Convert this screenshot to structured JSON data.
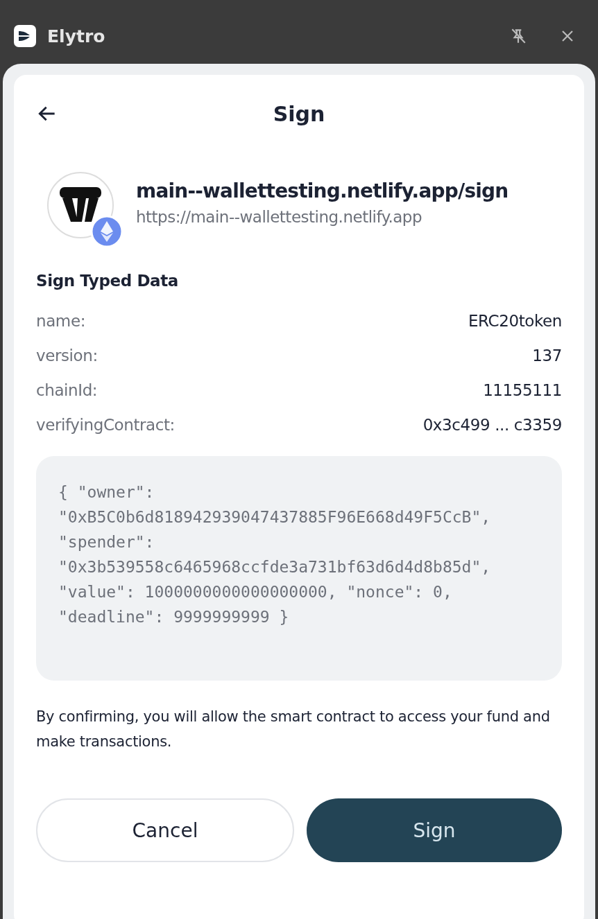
{
  "window": {
    "title": "Elytro",
    "pinned": false
  },
  "header": {
    "title": "Sign"
  },
  "site": {
    "title": "main--wallettesting.netlify.app/sign",
    "url": "https://main--wallettesting.netlify.app"
  },
  "section_title": "Sign Typed Data",
  "fields": [
    {
      "label": "name:",
      "value": "ERC20token"
    },
    {
      "label": "version:",
      "value": "137"
    },
    {
      "label": "chainId:",
      "value": "11155111"
    },
    {
      "label": "verifyingContract:",
      "value": "0x3c499 ... c3359"
    }
  ],
  "message": "{ \"owner\":\n\"0xB5C0b6d818942939047437885F96E668d49F5CcB\",\n\"spender\":\n\"0x3b539558c6465968ccfde3a731bf63d6d4d8b85d\",\n\"value\": 1000000000000000000, \"nonce\": 0,\n\"deadline\": 9999999999 }",
  "notice": "By confirming, you will allow the smart contract to access your fund and make transactions.",
  "buttons": [
    {
      "label": "Cancel",
      "kind": "secondary"
    },
    {
      "label": "Sign",
      "kind": "primary"
    }
  ]
}
